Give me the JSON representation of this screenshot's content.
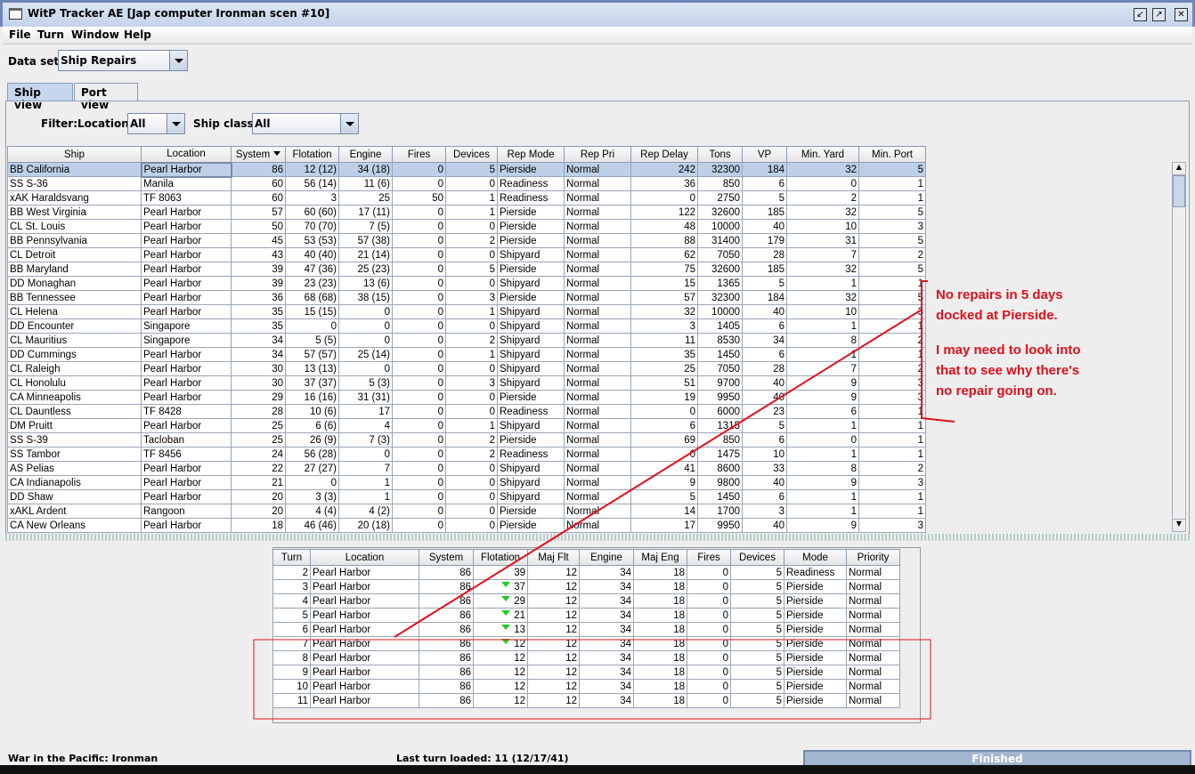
{
  "window": {
    "title": "WitP Tracker AE [Jap computer Ironman scen #10]"
  },
  "menu": [
    "File",
    "Turn",
    "Window",
    "Help"
  ],
  "dataset": {
    "label": "Data set:",
    "value": "Ship Repairs"
  },
  "tabs": [
    {
      "label": "Ship view",
      "active": true
    },
    {
      "label": "Port view",
      "active": false
    }
  ],
  "filter": {
    "label": "Filter:",
    "location_label": "Location:",
    "location_value": "All",
    "class_label": "Ship class:",
    "class_value": "All"
  },
  "ships": {
    "columns": [
      "Ship",
      "Location",
      "System",
      "Flotation",
      "Engine",
      "Fires",
      "Devices",
      "Rep Mode",
      "Rep Pri",
      "Rep Delay",
      "Tons",
      "VP",
      "Min. Yard",
      "Min. Port"
    ],
    "sort_column": "System",
    "sort_direction": "descending",
    "rows": [
      [
        "BB California",
        "Pearl Harbor",
        "86",
        "12 (12)",
        "34 (18)",
        "0",
        "5",
        "Pierside",
        "Normal",
        "242",
        "32300",
        "184",
        "32",
        "5"
      ],
      [
        "SS S-36",
        "Manila",
        "60",
        "56 (14)",
        "11 (6)",
        "0",
        "0",
        "Readiness",
        "Normal",
        "36",
        "850",
        "6",
        "0",
        "1"
      ],
      [
        "xAK Haraldsvang",
        "TF 8063",
        "60",
        "3",
        "25",
        "50",
        "1",
        "Readiness",
        "Normal",
        "0",
        "2750",
        "5",
        "2",
        "1"
      ],
      [
        "BB West Virginia",
        "Pearl Harbor",
        "57",
        "60 (60)",
        "17 (11)",
        "0",
        "1",
        "Pierside",
        "Normal",
        "122",
        "32600",
        "185",
        "32",
        "5"
      ],
      [
        "CL St. Louis",
        "Pearl Harbor",
        "50",
        "70 (70)",
        "7 (5)",
        "0",
        "0",
        "Pierside",
        "Normal",
        "48",
        "10000",
        "40",
        "10",
        "3"
      ],
      [
        "BB Pennsylvania",
        "Pearl Harbor",
        "45",
        "53 (53)",
        "57 (38)",
        "0",
        "2",
        "Pierside",
        "Normal",
        "88",
        "31400",
        "179",
        "31",
        "5"
      ],
      [
        "CL Detroit",
        "Pearl Harbor",
        "43",
        "40 (40)",
        "21 (14)",
        "0",
        "0",
        "Shipyard",
        "Normal",
        "62",
        "7050",
        "28",
        "7",
        "2"
      ],
      [
        "BB Maryland",
        "Pearl Harbor",
        "39",
        "47 (36)",
        "25 (23)",
        "0",
        "5",
        "Pierside",
        "Normal",
        "75",
        "32600",
        "185",
        "32",
        "5"
      ],
      [
        "DD Monaghan",
        "Pearl Harbor",
        "39",
        "23 (23)",
        "13 (6)",
        "0",
        "0",
        "Shipyard",
        "Normal",
        "15",
        "1365",
        "5",
        "1",
        "1"
      ],
      [
        "BB Tennessee",
        "Pearl Harbor",
        "36",
        "68 (68)",
        "38 (15)",
        "0",
        "3",
        "Pierside",
        "Normal",
        "57",
        "32300",
        "184",
        "32",
        "5"
      ],
      [
        "CL Helena",
        "Pearl Harbor",
        "35",
        "15 (15)",
        "0",
        "0",
        "1",
        "Shipyard",
        "Normal",
        "32",
        "10000",
        "40",
        "10",
        "3"
      ],
      [
        "DD Encounter",
        "Singapore",
        "35",
        "0",
        "0",
        "0",
        "0",
        "Shipyard",
        "Normal",
        "3",
        "1405",
        "6",
        "1",
        "1"
      ],
      [
        "CL Mauritius",
        "Singapore",
        "34",
        "5 (5)",
        "0",
        "0",
        "2",
        "Shipyard",
        "Normal",
        "11",
        "8530",
        "34",
        "8",
        "2"
      ],
      [
        "DD Cummings",
        "Pearl Harbor",
        "34",
        "57 (57)",
        "25 (14)",
        "0",
        "1",
        "Shipyard",
        "Normal",
        "35",
        "1450",
        "6",
        "1",
        "1"
      ],
      [
        "CL Raleigh",
        "Pearl Harbor",
        "30",
        "13 (13)",
        "0",
        "0",
        "0",
        "Shipyard",
        "Normal",
        "25",
        "7050",
        "28",
        "7",
        "2"
      ],
      [
        "CL Honolulu",
        "Pearl Harbor",
        "30",
        "37 (37)",
        "5 (3)",
        "0",
        "3",
        "Shipyard",
        "Normal",
        "51",
        "9700",
        "40",
        "9",
        "3"
      ],
      [
        "CA Minneapolis",
        "Pearl Harbor",
        "29",
        "16 (16)",
        "31 (31)",
        "0",
        "0",
        "Pierside",
        "Normal",
        "19",
        "9950",
        "40",
        "9",
        "3"
      ],
      [
        "CL Dauntless",
        "TF 8428",
        "28",
        "10 (6)",
        "17",
        "0",
        "0",
        "Readiness",
        "Normal",
        "0",
        "6000",
        "23",
        "6",
        "1"
      ],
      [
        "DM Pruitt",
        "Pearl Harbor",
        "25",
        "6 (6)",
        "4",
        "0",
        "1",
        "Shipyard",
        "Normal",
        "6",
        "1315",
        "5",
        "1",
        "1"
      ],
      [
        "SS S-39",
        "Tacloban",
        "25",
        "26 (9)",
        "7 (3)",
        "0",
        "2",
        "Pierside",
        "Normal",
        "69",
        "850",
        "6",
        "0",
        "1"
      ],
      [
        "SS Tambor",
        "TF 8456",
        "24",
        "56 (28)",
        "0",
        "0",
        "2",
        "Readiness",
        "Normal",
        "0",
        "1475",
        "10",
        "1",
        "1"
      ],
      [
        "AS Pelias",
        "Pearl Harbor",
        "22",
        "27 (27)",
        "7",
        "0",
        "0",
        "Shipyard",
        "Normal",
        "41",
        "8600",
        "33",
        "8",
        "2"
      ],
      [
        "CA Indianapolis",
        "Pearl Harbor",
        "21",
        "0",
        "1",
        "0",
        "0",
        "Shipyard",
        "Normal",
        "9",
        "9800",
        "40",
        "9",
        "3"
      ],
      [
        "DD Shaw",
        "Pearl Harbor",
        "20",
        "3 (3)",
        "1",
        "0",
        "0",
        "Shipyard",
        "Normal",
        "5",
        "1450",
        "6",
        "1",
        "1"
      ],
      [
        "xAKL Ardent",
        "Rangoon",
        "20",
        "4 (4)",
        "4 (2)",
        "0",
        "0",
        "Pierside",
        "Normal",
        "14",
        "1700",
        "3",
        "1",
        "1"
      ],
      [
        "CA New Orleans",
        "Pearl Harbor",
        "18",
        "46 (46)",
        "20 (18)",
        "0",
        "0",
        "Pierside",
        "Normal",
        "17",
        "9950",
        "40",
        "9",
        "3"
      ]
    ]
  },
  "history": {
    "columns": [
      "Turn",
      "Location",
      "System",
      "Flotation",
      "Maj Flt",
      "Engine",
      "Maj Eng",
      "Fires",
      "Devices",
      "Mode",
      "Priority"
    ],
    "rows": [
      {
        "cells": [
          "2",
          "Pearl Harbor",
          "86",
          "39",
          "12",
          "34",
          "18",
          "0",
          "5",
          "Readiness",
          "Normal"
        ],
        "flotation_decreased": false
      },
      {
        "cells": [
          "3",
          "Pearl Harbor",
          "86",
          "37",
          "12",
          "34",
          "18",
          "0",
          "5",
          "Pierside",
          "Normal"
        ],
        "flotation_decreased": true
      },
      {
        "cells": [
          "4",
          "Pearl Harbor",
          "86",
          "29",
          "12",
          "34",
          "18",
          "0",
          "5",
          "Pierside",
          "Normal"
        ],
        "flotation_decreased": true
      },
      {
        "cells": [
          "5",
          "Pearl Harbor",
          "86",
          "21",
          "12",
          "34",
          "18",
          "0",
          "5",
          "Pierside",
          "Normal"
        ],
        "flotation_decreased": true
      },
      {
        "cells": [
          "6",
          "Pearl Harbor",
          "86",
          "13",
          "12",
          "34",
          "18",
          "0",
          "5",
          "Pierside",
          "Normal"
        ],
        "flotation_decreased": true
      },
      {
        "cells": [
          "7",
          "Pearl Harbor",
          "86",
          "12",
          "12",
          "34",
          "18",
          "0",
          "5",
          "Pierside",
          "Normal"
        ],
        "flotation_decreased": true
      },
      {
        "cells": [
          "8",
          "Pearl Harbor",
          "86",
          "12",
          "12",
          "34",
          "18",
          "0",
          "5",
          "Pierside",
          "Normal"
        ],
        "flotation_decreased": false
      },
      {
        "cells": [
          "9",
          "Pearl Harbor",
          "86",
          "12",
          "12",
          "34",
          "18",
          "0",
          "5",
          "Pierside",
          "Normal"
        ],
        "flotation_decreased": false
      },
      {
        "cells": [
          "10",
          "Pearl Harbor",
          "86",
          "12",
          "12",
          "34",
          "18",
          "0",
          "5",
          "Pierside",
          "Normal"
        ],
        "flotation_decreased": false
      },
      {
        "cells": [
          "11",
          "Pearl Harbor",
          "86",
          "12",
          "12",
          "34",
          "18",
          "0",
          "5",
          "Pierside",
          "Normal"
        ],
        "flotation_decreased": false
      }
    ]
  },
  "status": {
    "left": "War in the Pacific: Ironman",
    "center": "Last turn loaded: 11 (12/17/41)",
    "progress": "Finished",
    "progress_percent": 100
  },
  "annotation": {
    "color": "#e0101a",
    "line1": "No repairs in 5 days",
    "line2": "docked at Pierside.",
    "line3": "I may need to look into",
    "line4": "that to see why there's",
    "line5": "no repair going on."
  },
  "colors": {
    "selection": "#bdd0e8",
    "decrease_arrow": "#22cc22",
    "progress": "#a3b6cf"
  }
}
